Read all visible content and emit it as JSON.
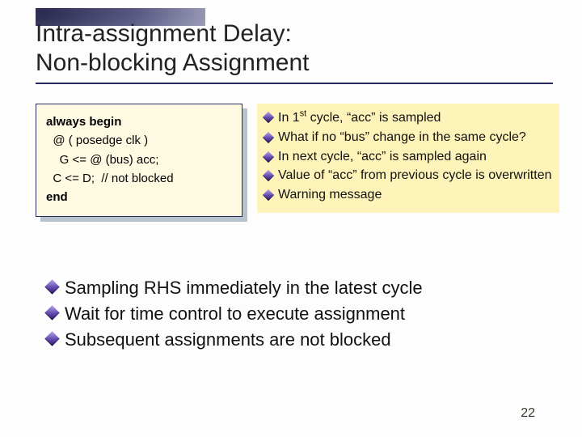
{
  "title": {
    "line1": "Intra-assignment Delay:",
    "line2": "Non-blocking Assignment"
  },
  "code": {
    "l1a": "always",
    "l1b": " ",
    "l1c": "begin",
    "l2": "  @ ( posedge clk )",
    "l3": "    G <= @ (bus) acc;",
    "l4": "  C <= D;  // not blocked",
    "l5": "end"
  },
  "notes": {
    "items": [
      {
        "pre": "In 1",
        "sup": "st",
        "post": " cycle, “acc” is sampled"
      },
      {
        "text": "What if no “bus” change in the same cycle?"
      },
      {
        "text": "In next cycle, “acc” is sampled again"
      },
      {
        "text": "Value of “acc” from previous cycle is overwritten"
      },
      {
        "text": "Warning message"
      }
    ]
  },
  "summary": {
    "items": [
      "Sampling RHS immediately in the latest cycle",
      "Wait for time control to execute assignment",
      "Subsequent assignments are not blocked"
    ]
  },
  "page_number": "22"
}
